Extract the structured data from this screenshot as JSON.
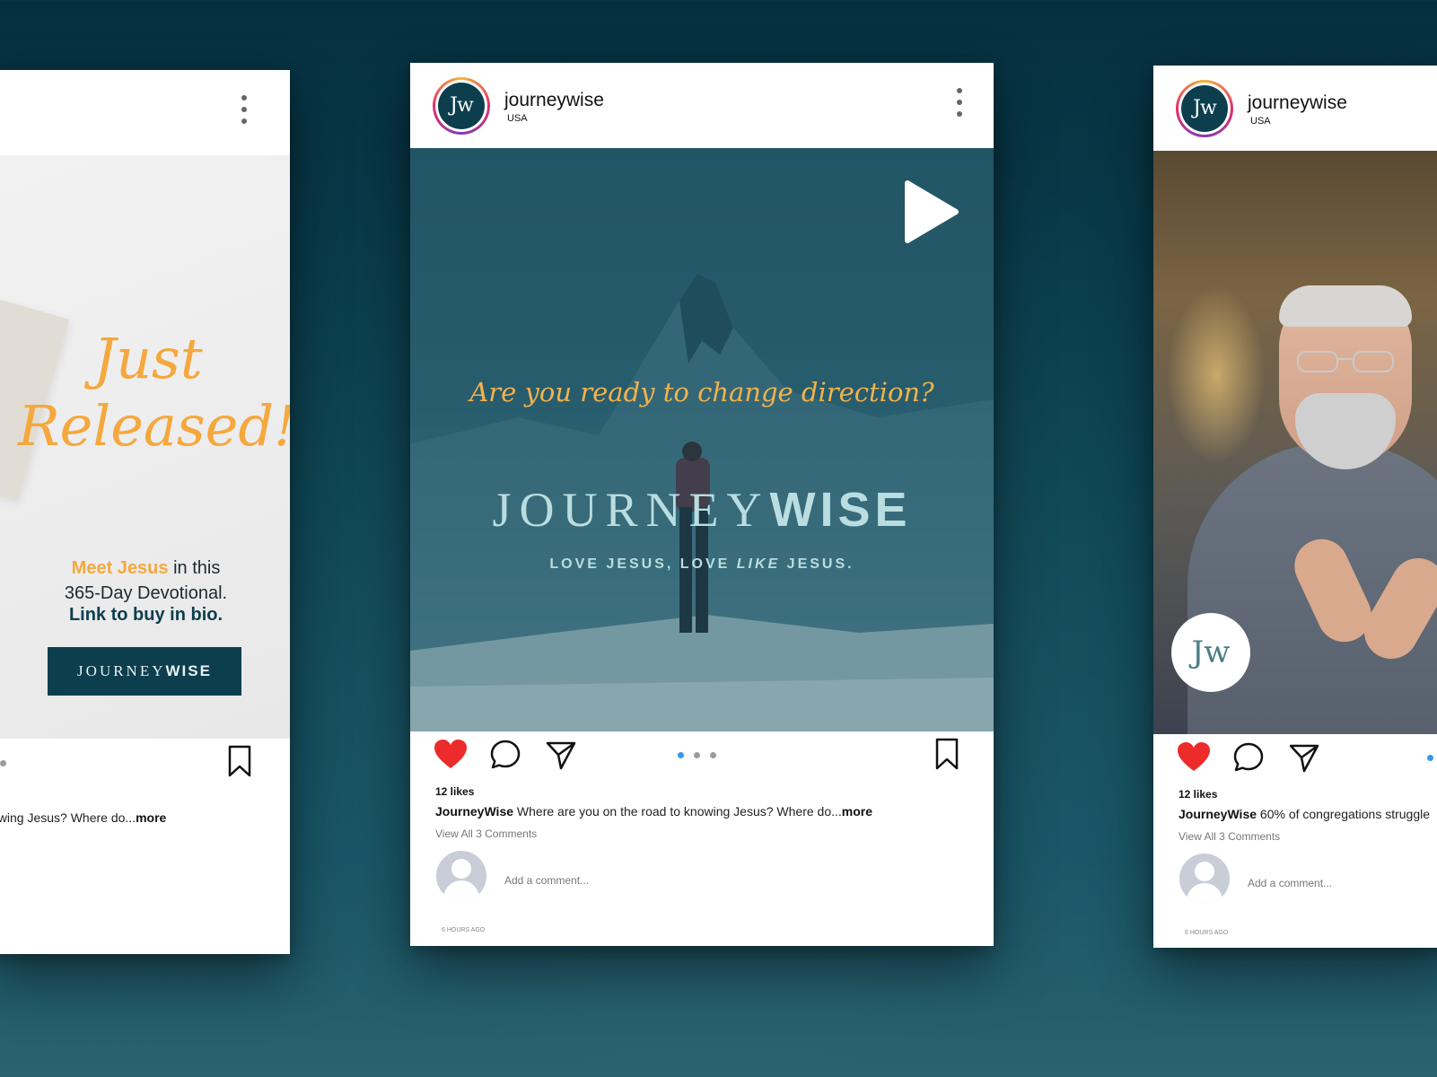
{
  "brand": {
    "accent": "#f5a83d",
    "navy": "#0c3e4e",
    "like_red": "#ed2b2b",
    "dot_blue": "#3897f0"
  },
  "avatar_initials": "Jw",
  "left_post": {
    "headline_line1": "Just",
    "headline_line2": "Released!",
    "promo_highlight": "Meet Jesus",
    "promo_rest": " in this",
    "promo_line2": "365-Day Devotional.",
    "promo_line3": "Link to buy in bio.",
    "logo_light": "JOURNEY",
    "logo_bold": "WISE",
    "caption_text": "owing Jesus? Where do...",
    "caption_more": "more",
    "carousel_active_index": 2
  },
  "center_post": {
    "username": "journeywise",
    "location": "USA",
    "tagline_script": "Are you ready to change direction?",
    "logo_light": "JOURNEY",
    "logo_bold": "WISE",
    "sub_part1": "LOVE JESUS, LOVE ",
    "sub_italic": "LIKE",
    "sub_part2": " JESUS.",
    "likes": "12 likes",
    "caption_user": "JourneyWise",
    "caption_text": " Where are you on the road to knowing Jesus? Where do...",
    "caption_more": "more",
    "view_comments": "View All 3 Comments",
    "add_comment_placeholder": "Add a comment...",
    "timestamp": "6 HOURS AGO",
    "carousel_active_index": 0,
    "liked": true
  },
  "right_post": {
    "username": "journeywise",
    "location": "USA",
    "badge_text": "Jw",
    "likes": "12 likes",
    "caption_user": "JourneyWise",
    "caption_text": " 60% of congregations struggle",
    "view_comments": "View All 3 Comments",
    "add_comment_placeholder": "Add a comment...",
    "timestamp": "6 HOURS AGO",
    "liked": true
  }
}
